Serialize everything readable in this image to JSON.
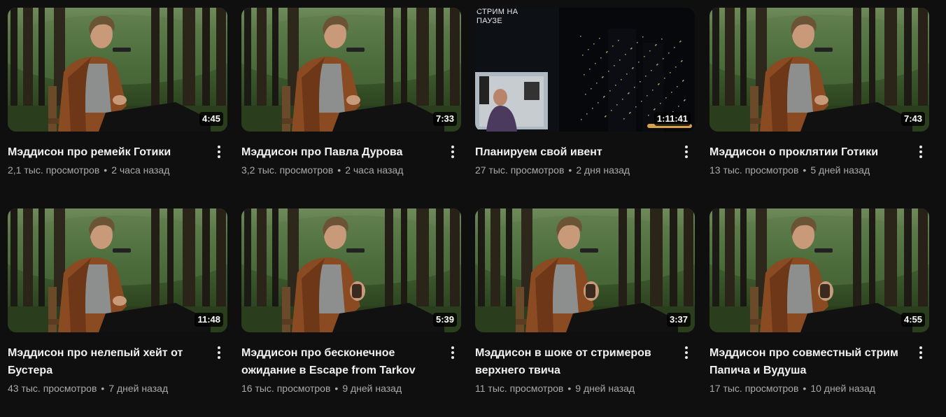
{
  "videos": [
    {
      "title": "Мэддисон про ремейк Готики",
      "views": "2,1 тыс. просмотров",
      "age": "2 часа назад",
      "duration": "4:45",
      "thumbnail": "forest-man"
    },
    {
      "title": "Мэддисон про Павла Дурова",
      "views": "3,2 тыс. просмотров",
      "age": "2 часа назад",
      "duration": "7:33",
      "thumbnail": "forest-man"
    },
    {
      "title": "Планируем свой ивент",
      "views": "27 тыс. просмотров",
      "age": "2 дня назад",
      "duration": "1:11:41",
      "thumbnail": "stream-pause",
      "thumb_text": "СТРИМ НА ПАУЗЕ"
    },
    {
      "title": "Мэддисон о проклятии Готики",
      "views": "13 тыс. просмотров",
      "age": "5 дней назад",
      "duration": "7:43",
      "thumbnail": "forest-man"
    },
    {
      "title": "Мэддисон про нелепый хейт от Бустера",
      "views": "43 тыс. просмотров",
      "age": "7 дней назад",
      "duration": "11:48",
      "thumbnail": "forest-man"
    },
    {
      "title": "Мэддисон про бесконечное ожидание в Escape from Tarkov",
      "views": "16 тыс. просмотров",
      "age": "9 дней назад",
      "duration": "5:39",
      "thumbnail": "forest-man-holding"
    },
    {
      "title": "Мэддисон в шоке от стримеров верхнего твича",
      "views": "11 тыс. просмотров",
      "age": "9 дней назад",
      "duration": "3:37",
      "thumbnail": "forest-man-holding"
    },
    {
      "title": "Мэддисон про совместный стрим Папича и Вудуша",
      "views": "17 тыс. просмотров",
      "age": "10 дней назад",
      "duration": "4:55",
      "thumbnail": "forest-man-holding"
    }
  ],
  "colors": {
    "background": "#0f0f0f",
    "title": "#f1f1f1",
    "meta": "#aaaaaa",
    "jacket": "#8a4a22",
    "forest": "#2f4a25",
    "progress": "#d6a34a"
  },
  "icons": {
    "more": "vertical-ellipsis-icon"
  }
}
